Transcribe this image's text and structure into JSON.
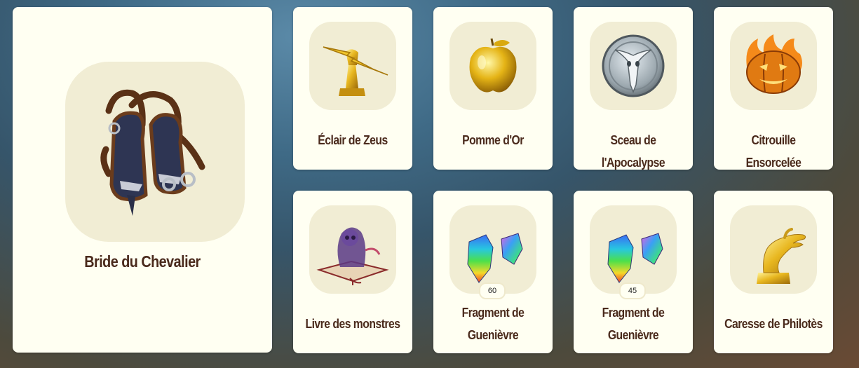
{
  "featured": {
    "name": "Bride du Chevalier",
    "icon": "bridle-icon"
  },
  "items": [
    {
      "name": "Éclair de Zeus",
      "icon": "lightning-trophy-icon"
    },
    {
      "name": "Pomme d'Or",
      "icon": "golden-apple-icon"
    },
    {
      "name": "Sceau de l'Apocalypse",
      "icon": "skull-seal-icon"
    },
    {
      "name": "Citrouille Ensorcelée",
      "icon": "flaming-pumpkin-icon"
    },
    {
      "name": "Livre des monstres",
      "icon": "monster-book-icon"
    },
    {
      "name_line1": "Fragment de",
      "name_line2": "Guenièvre",
      "count": "60",
      "icon": "crystal-fragment-icon"
    },
    {
      "name_line1": "Fragment de",
      "name_line2": "Guenièvre",
      "count": "45",
      "icon": "crystal-fragment-icon"
    },
    {
      "name": "Caresse de Philotès",
      "icon": "golden-hand-icon"
    }
  ],
  "colors": {
    "card": "#fffff2",
    "icon_bg": "#f1edd4",
    "text": "#4a2a1c",
    "gold": "#e0b22a"
  }
}
